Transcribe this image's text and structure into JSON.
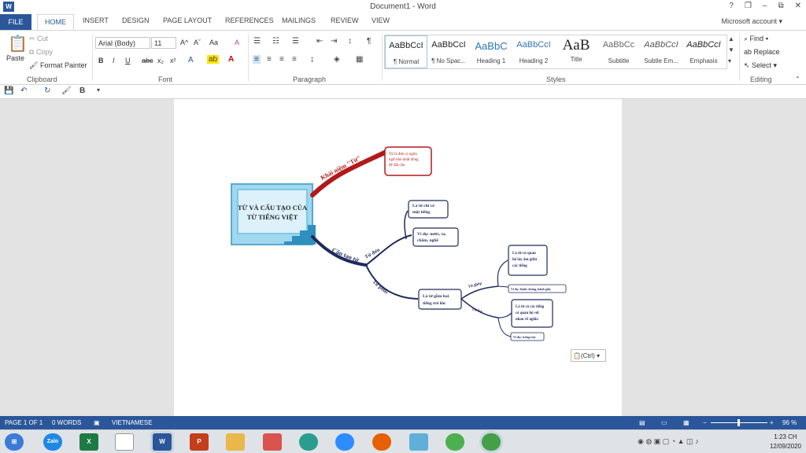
{
  "window": {
    "title": "Document1 - Word",
    "buttons": [
      "?",
      "❐",
      "–",
      "⧉",
      "✕"
    ]
  },
  "tabs": [
    "FILE",
    "HOME",
    "INSERT",
    "DESIGN",
    "PAGE LAYOUT",
    "REFERENCES",
    "MAILINGS",
    "REVIEW",
    "VIEW"
  ],
  "account": "Microsoft account ▾",
  "clipboard": {
    "paste": "Paste",
    "cut": "Cut",
    "copy": "Copy",
    "format_painter": "Format Painter",
    "label": "Clipboard"
  },
  "font": {
    "family": "Arial (Body)",
    "size": "11",
    "label": "Font",
    "bold": "B",
    "italic": "I",
    "underline": "U",
    "strike": "abc",
    "sub": "x₂",
    "sup": "x²",
    "grow": "A^",
    "shrink": "Aˇ",
    "case": "Aa",
    "clear": "A"
  },
  "paragraph": {
    "label": "Paragraph"
  },
  "styles": {
    "label": "Styles",
    "items": [
      {
        "sample": "AaBbCcI",
        "name": "¶ Normal"
      },
      {
        "sample": "AaBbCcI",
        "name": "¶ No Spac..."
      },
      {
        "sample": "AaBbC",
        "name": "Heading 1"
      },
      {
        "sample": "AaBbCcI",
        "name": "Heading 2"
      },
      {
        "sample": "AaB",
        "name": "Title"
      },
      {
        "sample": "AaBbCc",
        "name": "Subtitle"
      },
      {
        "sample": "AaBbCcI",
        "name": "Subtle Em..."
      },
      {
        "sample": "AaBbCcI",
        "name": "Emphasis"
      }
    ]
  },
  "editing": {
    "find": "Find ▾",
    "replace": "Replace",
    "select": "Select ▾",
    "label": "Editing"
  },
  "qat": {
    "bold": "B"
  },
  "mindmap": {
    "center": "TỪ VÀ CẤU TẠO CỦA TỪ TIẾNG VIỆT",
    "branch_concept": "Khái niệm \"Từ\"",
    "concept_note": "Từ là đơn vị ngôn ngữ nhỏ nhất dùng để đặt câu",
    "branch_structure": "Cấu tạo từ",
    "single": "Từ đơn",
    "single_def": "Là từ chỉ có một tiếng",
    "single_ex": "Ví dụ: nước, ta, chăm, nghề",
    "complex": "Từ phức",
    "complex_def": "Là từ gồm hai tiếng trở lên",
    "compound": "Từ ghép",
    "compound_def": "Là từ có quan hệ láy âm giữa các tiếng",
    "compound_ex": "Ví dụ: bánh chưng, bánh giầy",
    "reduplicative": "Từ láy",
    "redup_def": "Là từ có các tiếng có quan hệ với nhau về nghĩa",
    "redup_ex": "Ví dụ: trồng trọt"
  },
  "ctrl_tag": "(Ctrl) ▾",
  "status": {
    "page": "PAGE 1 OF 1",
    "words": "0 WORDS",
    "language": "VIETNAMESE",
    "zoom": "96 %",
    "zoom_level": 0.48
  },
  "taskbar": {
    "time": "1:23 CH",
    "date": "12/09/2020",
    "apps": [
      "Zalo",
      "X",
      "W",
      "P"
    ]
  },
  "colors": {
    "accent": "#2b579a",
    "concept_branch": "#b11a1a",
    "structure_branch": "#1f2a5c",
    "center_fill": "#7ec8e8"
  }
}
